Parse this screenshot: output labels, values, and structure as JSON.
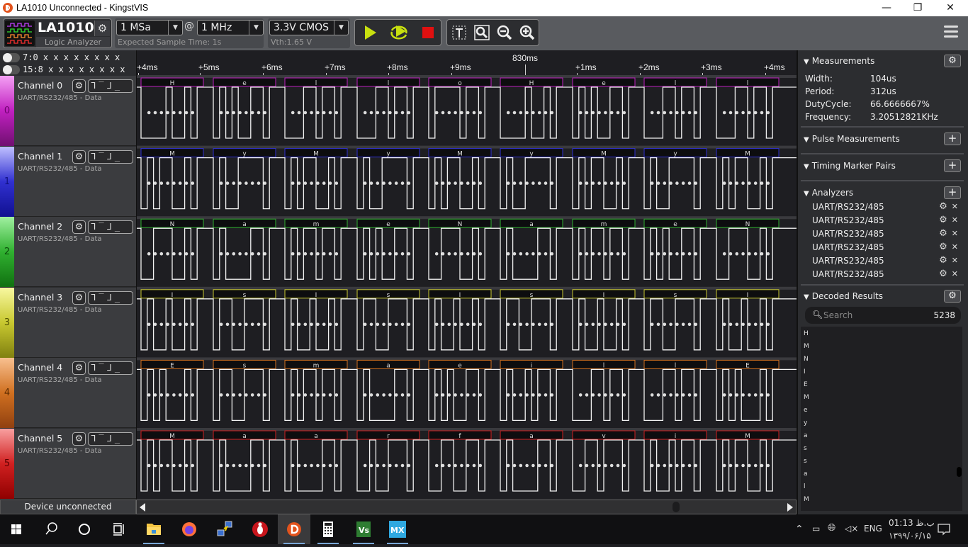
{
  "window": {
    "title": "LA1010 Unconnected - KingstVIS",
    "minimize": "—",
    "restore": "❐",
    "close": "✕"
  },
  "toolbar": {
    "device_name": "LA1010",
    "device_subtitle": "Logic Analyzer",
    "sample_depth": "1 MSa",
    "at_symbol": "@",
    "sample_rate": "1 MHz",
    "expected_sample_time": "Expected Sample Time: 1s",
    "voltage_standard": "3.3V CMOS",
    "threshold": "Vth:1.65 V",
    "dropdown_arrow": "▼",
    "gear": "⚙",
    "colors": {
      "run": "#c8e00f",
      "stop": "#e01010"
    }
  },
  "channel_groups": [
    {
      "label": "7:0  x x x x x x x x"
    },
    {
      "label": "15:8 x x x x x x x x"
    }
  ],
  "channels": [
    {
      "index": "0",
      "name": "Channel 0",
      "analyzer": "UART/RS232/485 - Data",
      "color": "#c020c0",
      "grad_top": "#f4a0f4",
      "grad_bot": "#701070",
      "num_color": "#6a006a",
      "decoded": [
        "H",
        "e",
        "l",
        "l",
        "o",
        "H",
        "e",
        "l",
        "l"
      ]
    },
    {
      "index": "1",
      "name": "Channel 1",
      "analyzer": "UART/RS232/485 - Data",
      "color": "#3030d0",
      "grad_top": "#c0c0ff",
      "grad_bot": "#101090",
      "num_color": "#101080",
      "decoded": [
        "M",
        "y",
        "M",
        "y",
        "M",
        "y",
        "M",
        "y",
        "M"
      ]
    },
    {
      "index": "2",
      "name": "Channel 2",
      "analyzer": "UART/RS232/485 - Data",
      "color": "#30b030",
      "grad_top": "#a0f0a0",
      "grad_bot": "#107010",
      "num_color": "#0a4a0a",
      "decoded": [
        "N",
        "a",
        "m",
        "e",
        "N",
        "a",
        "m",
        "e",
        "N"
      ]
    },
    {
      "index": "3",
      "name": "Channel 3",
      "analyzer": "UART/RS232/485 - Data",
      "color": "#c8c830",
      "grad_top": "#f8f8a0",
      "grad_bot": "#808010",
      "num_color": "#505000",
      "decoded": [
        "I",
        "s",
        "I",
        "s",
        "I",
        "s",
        "I",
        "s",
        "I"
      ]
    },
    {
      "index": "4",
      "name": "Channel 4",
      "analyzer": "UART/RS232/485 - Data",
      "color": "#d07020",
      "grad_top": "#f8c090",
      "grad_bot": "#904010",
      "num_color": "#5a2a00",
      "decoded": [
        "E",
        "s",
        "m",
        "a",
        "e",
        "i",
        "l",
        "l",
        "E"
      ]
    },
    {
      "index": "5",
      "name": "Channel 5",
      "analyzer": "UART/RS232/485 - Data",
      "color": "#d02020",
      "grad_top": "#f8a0a0",
      "grad_bot": "#900000",
      "num_color": "#5a0000",
      "decoded": [
        "M",
        "a",
        "a",
        "r",
        "f",
        "a",
        "v",
        "i",
        "M"
      ]
    }
  ],
  "trigger_glyphs": "ᒣ‾ᒧ_",
  "ruler": {
    "cursor_label": "830ms",
    "ticks": [
      "+4ms",
      "+5ms",
      "+6ms",
      "+7ms",
      "+8ms",
      "+9ms",
      "+1ms",
      "+2ms",
      "+3ms",
      "+4ms"
    ]
  },
  "status": {
    "device": "Device unconnected"
  },
  "panel": {
    "measurements": {
      "title": "Measurements",
      "rows": [
        {
          "label": "Width:",
          "value": "104us"
        },
        {
          "label": "Period:",
          "value": "312us"
        },
        {
          "label": "DutyCycle:",
          "value": "66.6666667%"
        },
        {
          "label": "Frequency:",
          "value": "3.20512821KHz"
        }
      ]
    },
    "pulse_measurements": {
      "title": "Pulse Measurements"
    },
    "timing_marker_pairs": {
      "title": "Timing Marker Pairs"
    },
    "analyzers": {
      "title": "Analyzers",
      "items": [
        "UART/RS232/485",
        "UART/RS232/485",
        "UART/RS232/485",
        "UART/RS232/485",
        "UART/RS232/485",
        "UART/RS232/485"
      ]
    },
    "decoded_results": {
      "title": "Decoded Results",
      "search_placeholder": "Search",
      "count": "5238",
      "items": [
        "H",
        "M",
        "N",
        "I",
        "E",
        "M",
        "e",
        "y",
        "a",
        "s",
        "s",
        "a",
        "l",
        "M"
      ]
    },
    "plus": "+",
    "triangle": "▼",
    "x": "✕"
  },
  "taskbar": {
    "apps": [
      "start",
      "search",
      "cortana",
      "task-view",
      "file-explorer",
      "firefox",
      "network-tool",
      "antivirus",
      "kingstvis",
      "calculator",
      "visual-studio",
      "mx"
    ],
    "language": "ENG",
    "time": "01:13 ب.ظ",
    "date": "۱۳۹۹/۰۶/۱۵"
  }
}
